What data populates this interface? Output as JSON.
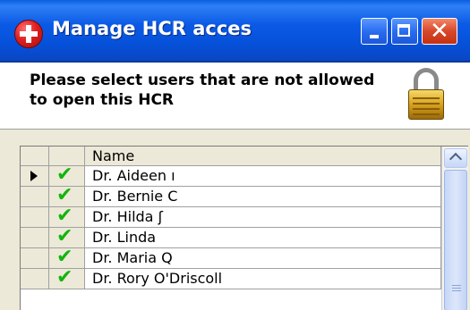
{
  "window": {
    "title": "Manage HCR acces",
    "icon": "red-cross-icon"
  },
  "title_buttons": [
    "minimize",
    "maximize",
    "close"
  ],
  "header": {
    "instruction": "Please select users that are not allowed to open this HCR",
    "icon": "lock-icon"
  },
  "grid": {
    "columns": {
      "name": "Name"
    },
    "rows": [
      {
        "name": "Dr. Aideen ı",
        "checked": true,
        "current": true
      },
      {
        "name": "Dr. Bernie C",
        "checked": true,
        "current": false
      },
      {
        "name": "Dr. Hilda ʃ",
        "checked": true,
        "current": false
      },
      {
        "name": "Dr. Linda",
        "checked": true,
        "current": false
      },
      {
        "name": "Dr. Maria Q",
        "checked": true,
        "current": false
      },
      {
        "name": "Dr. Rory O'Driscoll",
        "checked": true,
        "current": false
      }
    ]
  },
  "colors": {
    "titlebar": "#0a5ee0",
    "check": "#12b40e",
    "close_button": "#d8472a"
  }
}
